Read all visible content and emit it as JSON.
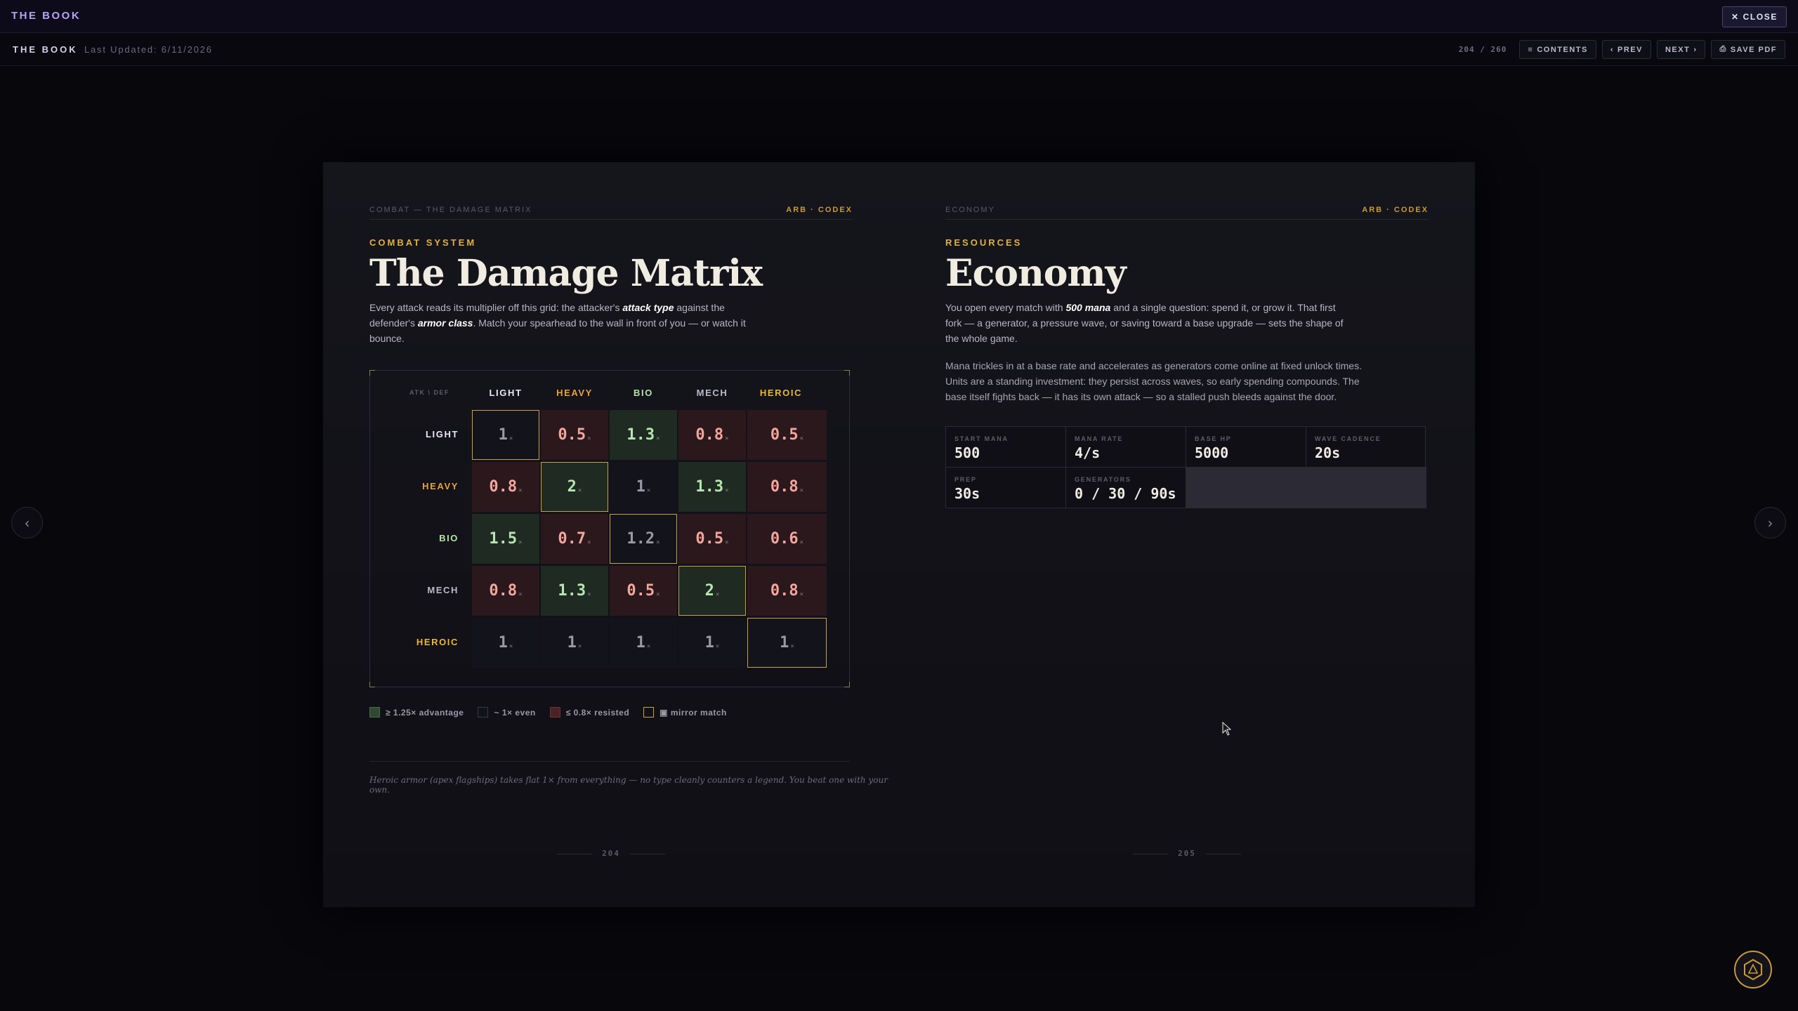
{
  "topbar": {
    "brand": "THE BOOK",
    "close_label": "CLOSE"
  },
  "subbar": {
    "title": "THE BOOK",
    "updated": "Last Updated: 6/11/2026",
    "page_count": "204 / 260",
    "contents": "CONTENTS",
    "prev": "PREV",
    "next": "NEXT",
    "save": "SAVE PDF"
  },
  "left": {
    "section": "COMBAT — THE DAMAGE MATRIX",
    "codex": "ARB · CODEX",
    "eyebrow": "COMBAT SYSTEM",
    "title": "The Damage Matrix",
    "intro": {
      "p1": "Every attack reads its multiplier off this grid: the attacker's ",
      "e1": "attack type",
      "p2": " against the defender's ",
      "e2": "armor class",
      "p3": ". Match your spearhead to the wall in front of you — or watch it bounce."
    },
    "matrix": {
      "axis": "ATK \\ DEF",
      "columns": [
        "LIGHT",
        "HEAVY",
        "BIO",
        "MECH",
        "HEROIC"
      ],
      "rows": [
        {
          "label": "LIGHT",
          "cells": [
            "1",
            "0.5",
            "1.3",
            "0.8",
            "0.5"
          ]
        },
        {
          "label": "HEAVY",
          "cells": [
            "0.8",
            "2",
            "1",
            "1.3",
            "0.8"
          ]
        },
        {
          "label": "BIO",
          "cells": [
            "1.5",
            "0.7",
            "1.2",
            "0.5",
            "0.6"
          ]
        },
        {
          "label": "MECH",
          "cells": [
            "0.8",
            "1.3",
            "0.5",
            "2",
            "0.8"
          ]
        },
        {
          "label": "HEROIC",
          "cells": [
            "1",
            "1",
            "1",
            "1",
            "1"
          ]
        }
      ],
      "suffix": "×"
    },
    "legend": {
      "adv": "≥ 1.25× advantage",
      "even": "~ 1× even",
      "res": "≤ 0.8× resisted",
      "mirror": "▣ mirror match"
    },
    "footnote": "Heroic armor (apex flagships) takes flat 1× from everything — no type cleanly counters a legend. You beat one with your own.",
    "page_number": "204"
  },
  "right": {
    "section": "ECONOMY",
    "codex": "ARB · CODEX",
    "eyebrow": "RESOURCES",
    "title": "Economy",
    "intro": {
      "p1": "You open every match with ",
      "e1": "500 mana",
      "p2": " and a single question: spend it, or grow it. That first fork — a generator, a pressure wave, or saving toward a base upgrade — sets the shape of the whole game."
    },
    "intro2": "Mana trickles in at a base rate and accelerates as generators come online at fixed unlock times. Units are a standing investment: they persist across waves, so early spending compounds. The base itself fights back — it has its own attack — so a stalled push bleeds against the door.",
    "stats": [
      {
        "key": "START MANA",
        "value": "500"
      },
      {
        "key": "MANA RATE",
        "value": "4/s"
      },
      {
        "key": "BASE HP",
        "value": "5000"
      },
      {
        "key": "WAVE CADENCE",
        "value": "20s"
      },
      {
        "key": "PREP",
        "value": "30s"
      },
      {
        "key": "GENERATORS",
        "value": "0 / 30 / 90s"
      }
    ],
    "page_number": "205"
  },
  "icons": {
    "close": "close-icon",
    "contents": "list-icon",
    "prev": "chevron-left-icon",
    "next": "chevron-right-icon",
    "save": "download-icon",
    "badge": "hexagon-emblem-icon"
  },
  "colors": {
    "accent_gold": "#e0b043",
    "advantage": "#1f2b22",
    "resisted": "#2a181c",
    "even": "#13131b",
    "mirror_outline": "#caa13b"
  }
}
